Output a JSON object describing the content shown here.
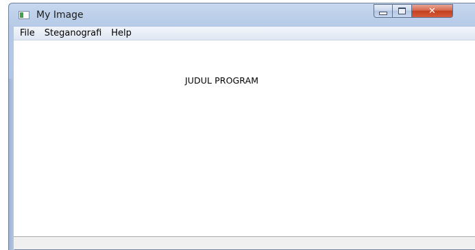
{
  "window": {
    "title": "My Image",
    "icon": "app-window-icon",
    "buttons": {
      "minimize_icon": "minimize-icon",
      "maximize_icon": "maximize-icon",
      "close_icon": "close-icon"
    }
  },
  "menubar": {
    "items": [
      {
        "label": "File"
      },
      {
        "label": "Steganografi"
      },
      {
        "label": "Help"
      }
    ]
  },
  "main": {
    "program_title": "JUDUL PROGRAM"
  },
  "statusbar": {
    "text": ""
  },
  "colors": {
    "frame": "#a7bde0",
    "close_button": "#c2401f",
    "client_background": "#ffffff"
  }
}
